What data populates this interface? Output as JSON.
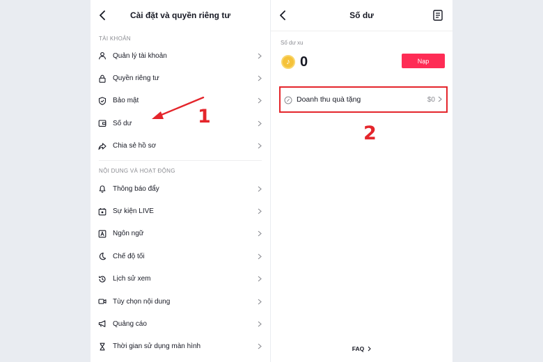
{
  "left": {
    "title": "Cài đặt và quyền riêng tư",
    "section_account": "TÀI KHOẢN",
    "account_items": [
      {
        "label": "Quản lý tài khoản",
        "icon": "person-icon"
      },
      {
        "label": "Quyền riêng tư",
        "icon": "lock-icon"
      },
      {
        "label": "Bảo mật",
        "icon": "shield-icon"
      },
      {
        "label": "Số dư",
        "icon": "wallet-icon"
      },
      {
        "label": "Chia sẻ hồ sơ",
        "icon": "share-icon"
      }
    ],
    "section_content": "NỘI DUNG VÀ HOẠT ĐỘNG",
    "content_items": [
      {
        "label": "Thông báo đẩy",
        "icon": "bell-icon"
      },
      {
        "label": "Sự kiện LIVE",
        "icon": "live-event-icon"
      },
      {
        "label": "Ngôn ngữ",
        "icon": "language-icon"
      },
      {
        "label": "Chế độ tối",
        "icon": "moon-icon"
      },
      {
        "label": "Lịch sử xem",
        "icon": "history-icon"
      },
      {
        "label": "Tùy chọn nội dung",
        "icon": "video-icon"
      },
      {
        "label": "Quảng cáo",
        "icon": "megaphone-icon"
      },
      {
        "label": "Thời gian sử dụng màn hình",
        "icon": "hourglass-icon"
      }
    ]
  },
  "right": {
    "title": "Số dư",
    "balance_label": "Số dư xu",
    "balance_value": "0",
    "recharge_label": "Nạp",
    "gift_label": "Doanh thu quà tặng",
    "gift_value": "$0",
    "faq_label": "FAQ"
  },
  "annotations": {
    "step1": "1",
    "step2": "2",
    "highlight_color": "#e4252b"
  },
  "colors": {
    "accent": "#fe2c55",
    "text": "#161823",
    "muted": "#8a8b91"
  }
}
